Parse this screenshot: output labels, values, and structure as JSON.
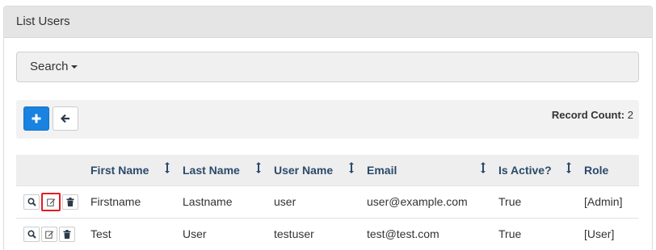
{
  "panel": {
    "title": "List Users"
  },
  "search": {
    "label": "Search"
  },
  "toolbar": {
    "add_icon": "plus-icon",
    "back_icon": "arrow-left-icon",
    "record_count_label": "Record Count:",
    "record_count_value": "2"
  },
  "table": {
    "headers": [
      "First Name",
      "Last Name",
      "User Name",
      "Email",
      "Is Active?",
      "Role"
    ],
    "rows": [
      {
        "first_name": "Firstname",
        "last_name": "Lastname",
        "user_name": "user",
        "email": "user@example.com",
        "is_active": "True",
        "role": "[Admin]"
      },
      {
        "first_name": "Test",
        "last_name": "User",
        "user_name": "testuser",
        "email": "test@test.com",
        "is_active": "True",
        "role": "[User]"
      }
    ]
  },
  "colors": {
    "accent": "#1a82e0",
    "highlight": "#e31b23",
    "header_text": "#2b4a6b"
  }
}
